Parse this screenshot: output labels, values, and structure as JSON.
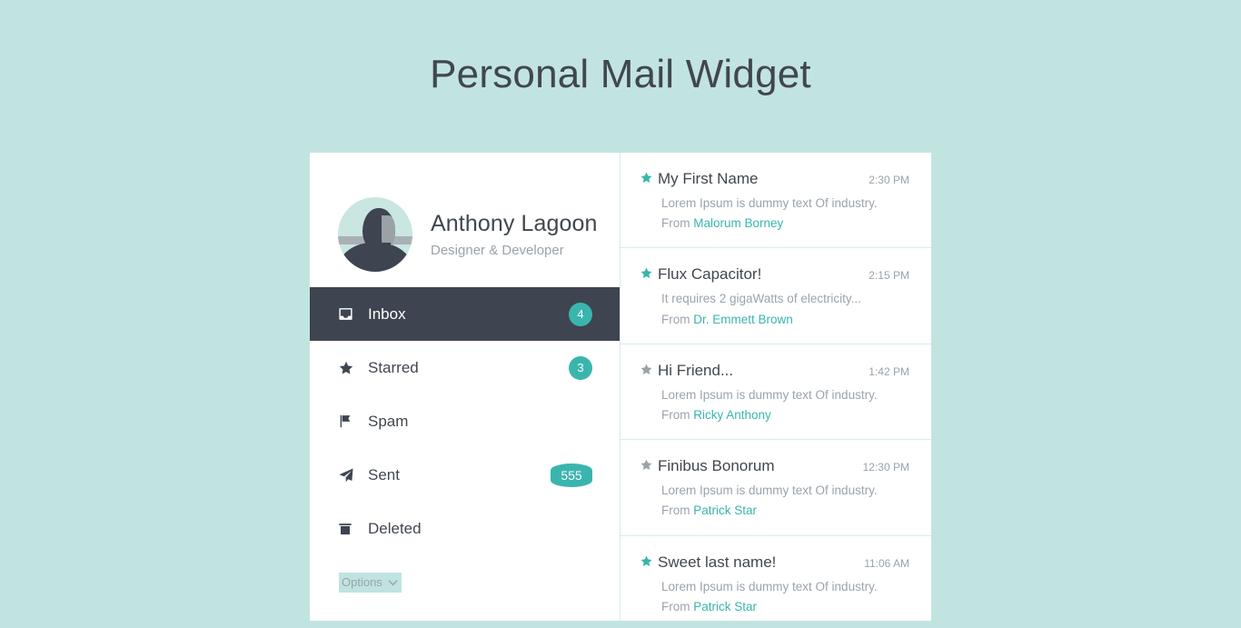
{
  "page": {
    "title": "Personal Mail Widget",
    "background_color": "#c2e4e0",
    "accent_color": "#3ab5ae",
    "dark_color": "#3e4450"
  },
  "profile": {
    "name": "Anthony Lagoon",
    "role": "Designer & Developer",
    "avatar_icon": "user-portrait-avatar"
  },
  "sidebar": {
    "items": [
      {
        "label": "Inbox",
        "icon": "inbox-icon",
        "badge": "4",
        "active": true
      },
      {
        "label": "Starred",
        "icon": "star-icon",
        "badge": "3",
        "active": false
      },
      {
        "label": "Spam",
        "icon": "flag-icon",
        "badge": "",
        "active": false
      },
      {
        "label": "Sent",
        "icon": "paper-plane-icon",
        "badge": "555",
        "active": false
      },
      {
        "label": "Deleted",
        "icon": "trash-icon",
        "badge": "",
        "active": false
      }
    ],
    "options": {
      "label": "Options",
      "chevron_icon": "chevron-down-icon"
    }
  },
  "maillist": {
    "from_prefix": "From ",
    "items": [
      {
        "subject": "My First Name",
        "time": "2:30 PM",
        "preview": "Lorem Ipsum is dummy text Of industry.",
        "sender": "Malorum Borney",
        "starred": true
      },
      {
        "subject": "Flux Capacitor!",
        "time": "2:15 PM",
        "preview": "It requires 2 gigaWatts of electricity...",
        "sender": "Dr. Emmett Brown",
        "starred": true
      },
      {
        "subject": "Hi Friend...",
        "time": "1:42 PM",
        "preview": "Lorem Ipsum is dummy text Of industry.",
        "sender": "Ricky Anthony",
        "starred": false
      },
      {
        "subject": "Finibus Bonorum",
        "time": "12:30 PM",
        "preview": "Lorem Ipsum is dummy text Of industry.",
        "sender": "Patrick Star",
        "starred": false
      },
      {
        "subject": "Sweet last name!",
        "time": "11:06 AM",
        "preview": "Lorem Ipsum is dummy text Of industry.",
        "sender": "Patrick Star",
        "starred": true
      }
    ]
  }
}
